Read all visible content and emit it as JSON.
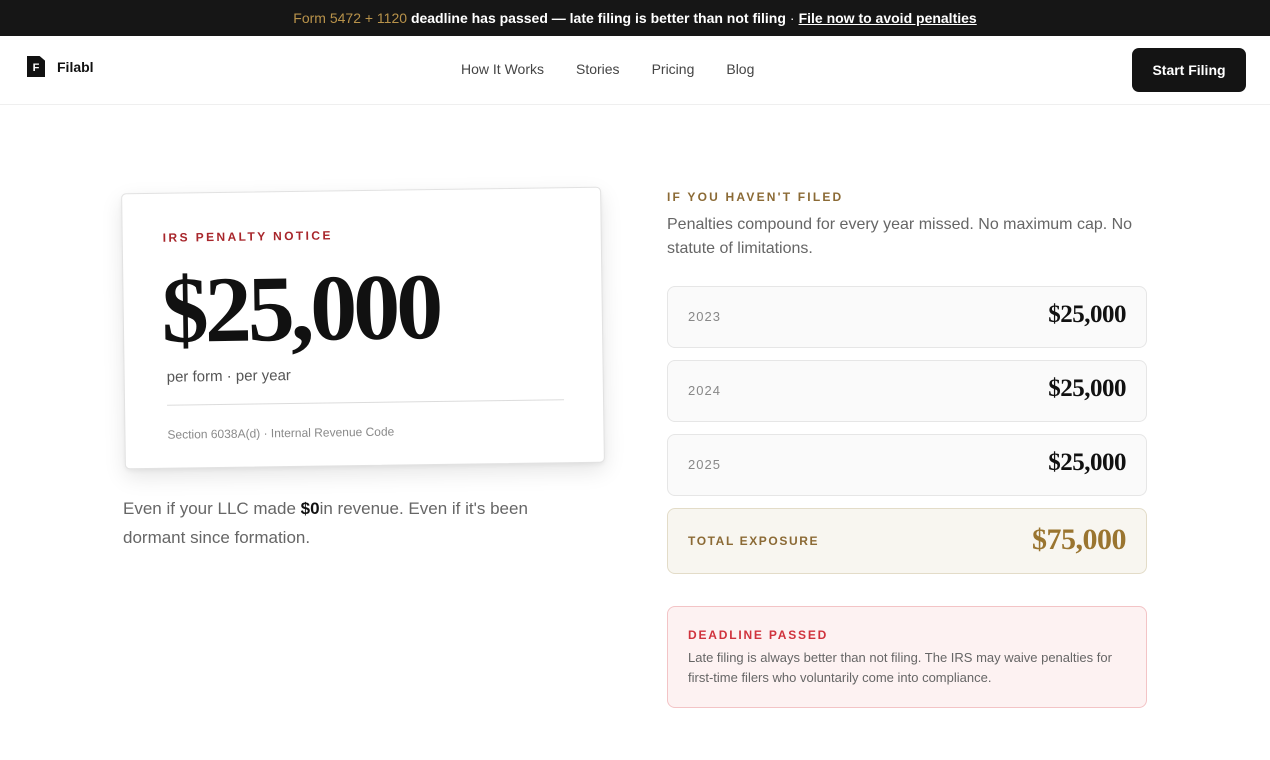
{
  "banner": {
    "forms": "Form 5472 + 1120",
    "middle": "deadline has passed — late filing is better than not filing",
    "separator": "·",
    "link": "File now to avoid penalties"
  },
  "nav": {
    "logo_letter": "F",
    "logo_text": "Filabl",
    "links": [
      "How It Works",
      "Stories",
      "Pricing",
      "Blog"
    ],
    "cta": "Start Filing"
  },
  "notice": {
    "label": "IRS PENALTY NOTICE",
    "amount": "$25,000",
    "sub": "per form · per year",
    "citation": "Section 6038A(d) · Internal Revenue Code"
  },
  "left_desc": {
    "before": "Even if your LLC made ",
    "bold": "$0",
    "after": "in revenue. Even if it's been dormant since formation."
  },
  "right": {
    "eyebrow": "IF YOU HAVEN'T FILED",
    "intro": "Penalties compound for every year missed. No maximum cap. No statute of limitations.",
    "years": [
      {
        "year": "2023",
        "amount": "$25,000"
      },
      {
        "year": "2024",
        "amount": "$25,000"
      },
      {
        "year": "2025",
        "amount": "$25,000"
      }
    ],
    "total": {
      "label": "TOTAL EXPOSURE",
      "amount": "$75,000"
    },
    "deadline": {
      "label": "DEADLINE PASSED",
      "text": "Late filing is always better than not filing. The IRS may waive penalties for first-time filers who voluntarily come into compliance."
    }
  },
  "colors": {
    "accent_gold": "#9a7530",
    "alert_red": "#d0333d",
    "dark": "#141414"
  }
}
